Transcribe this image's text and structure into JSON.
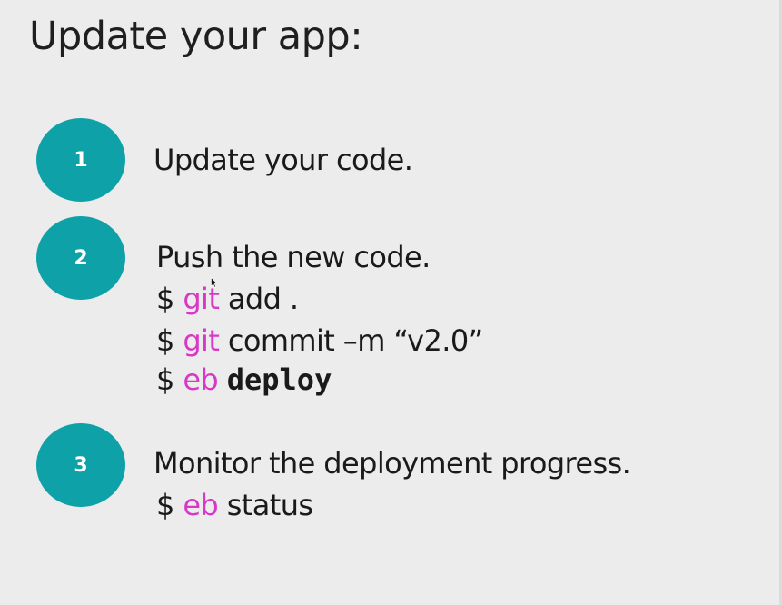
{
  "slide": {
    "title": "Update your app:"
  },
  "steps": [
    {
      "number": "1",
      "heading": "Update your code.",
      "commands": []
    },
    {
      "number": "2",
      "heading": "Push the new code.",
      "commands": [
        {
          "prompt": "$",
          "tool": "git",
          "args": "add ."
        },
        {
          "prompt": "$",
          "tool": "git",
          "args": "commit –m “v2.0”"
        },
        {
          "prompt": "$",
          "tool": "eb",
          "args": "deploy"
        }
      ]
    },
    {
      "number": "3",
      "heading": "Monitor the deployment progress.",
      "commands": [
        {
          "prompt": "$",
          "tool": "eb",
          "args": "status"
        }
      ]
    }
  ],
  "colors": {
    "background": "#ececec",
    "circle": "#0ea1a7",
    "tool_highlight": "#d838c8",
    "text": "#1a1a1a"
  },
  "icons": {
    "cursor": "mouse-pointer-icon"
  }
}
